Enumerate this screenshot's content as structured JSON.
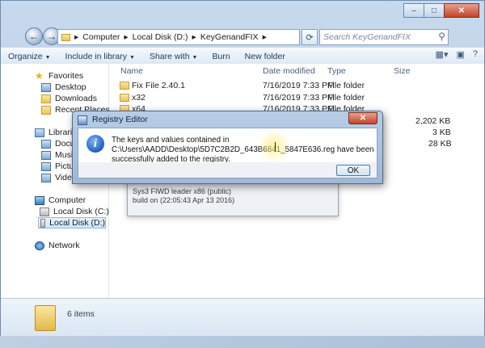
{
  "address": {
    "crumbs": [
      "Computer",
      "Local Disk (D:)",
      "KeyGenandFIX"
    ],
    "search_placeholder": "Search KeyGenandFIX"
  },
  "toolbar": {
    "organize": "Organize",
    "include": "Include in library",
    "share": "Share with",
    "burn": "Burn",
    "new_folder": "New folder"
  },
  "nav": {
    "favorites": "Favorites",
    "desktop": "Desktop",
    "downloads": "Downloads",
    "recent": "Recent Places",
    "libraries": "Libraries",
    "documents": "Documents",
    "music": "Music",
    "pictures": "Pictures",
    "videos": "Videos",
    "computer": "Computer",
    "disk_c": "Local Disk (C:)",
    "disk_d": "Local Disk (D:)",
    "network": "Network"
  },
  "columns": {
    "name": "Name",
    "date": "Date modified",
    "type": "Type",
    "size": "Size"
  },
  "files": [
    {
      "name": "Fix File 2.40.1",
      "date": "7/16/2019 7:33 PM",
      "type": "File folder",
      "size": ""
    },
    {
      "name": "x32",
      "date": "7/16/2019 7:33 PM",
      "type": "File folder",
      "size": ""
    },
    {
      "name": "x64",
      "date": "7/16/2019 7:33 PM",
      "type": "File folder",
      "size": ""
    },
    {
      "name": "",
      "date": "",
      "type": "",
      "size": "2,202 KB"
    },
    {
      "name": "",
      "date": "",
      "type": "",
      "size": "3 KB"
    },
    {
      "name": "",
      "date": "",
      "type": "",
      "size": "28 KB"
    }
  ],
  "background_window": {
    "line1": "Sys3 FIWD leader x86 (public)",
    "line2": "build on (22:05:43 Apr 13 2016)"
  },
  "details": {
    "count": "6 items"
  },
  "dialog": {
    "title": "Registry Editor",
    "message": "The keys and values contained in C:\\Users\\AADD\\Desktop\\5D7C2B2D_643B6841_5847E636.reg have been successfully added to the registry.",
    "ok": "OK"
  }
}
